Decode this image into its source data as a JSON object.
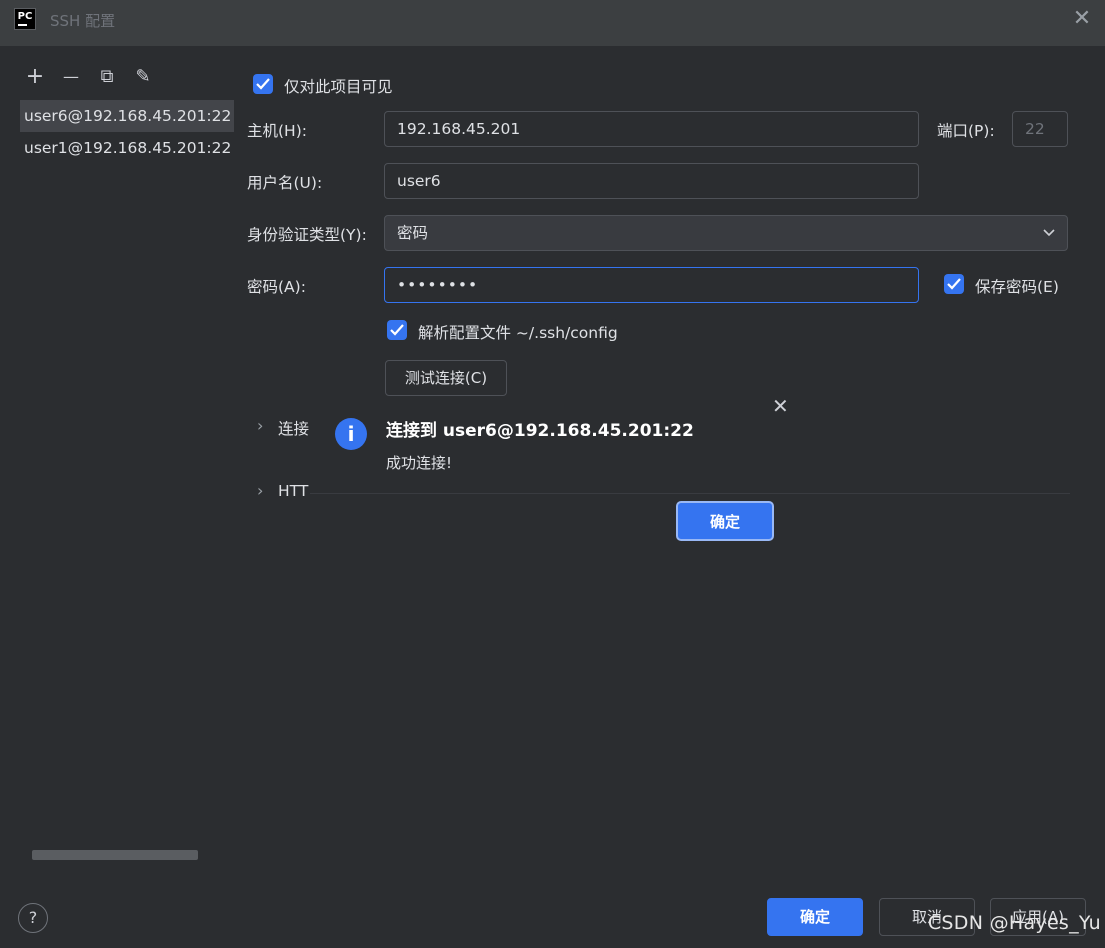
{
  "window": {
    "title": "SSH 配置",
    "logo_text": "PC",
    "close_glyph": "✕"
  },
  "toolbar": {
    "add_glyph": "+",
    "remove_glyph": "—",
    "copy_glyph": "⧉",
    "edit_glyph": "✎"
  },
  "hosts": [
    {
      "label": "user6@192.168.45.201:22",
      "selected": true
    },
    {
      "label": "user1@192.168.45.201:22",
      "selected": false
    }
  ],
  "form": {
    "visible_only_project_label": "仅对此项目可见",
    "host_label": "主机(H):",
    "host_value": "192.168.45.201",
    "port_label": "端口(P):",
    "port_value": "22",
    "username_label": "用户名(U):",
    "username_value": "user6",
    "auth_type_label": "身份验证类型(Y):",
    "auth_type_value": "密码",
    "password_label": "密码(A):",
    "password_value": "••••••••",
    "save_password_label": "保存密码(E)",
    "parse_config_label": "解析配置文件 ~/.ssh/config",
    "test_connection_button": "测试连接(C)"
  },
  "sections": {
    "connection_label": "连接",
    "http_label": "HTT"
  },
  "popup": {
    "info_glyph": "i",
    "title": "连接到 user6@192.168.45.201:22",
    "message": "成功连接!",
    "ok_button": "确定",
    "close_glyph": "✕"
  },
  "footer": {
    "help_glyph": "?",
    "ok_button": "确定",
    "cancel_button": "取消",
    "apply_button": "应用(A)"
  },
  "watermark": "CSDN @Hayes_Yu",
  "colors": {
    "accent": "#3574f0",
    "background": "#2b2d30",
    "titlebar": "#3c3f41"
  }
}
